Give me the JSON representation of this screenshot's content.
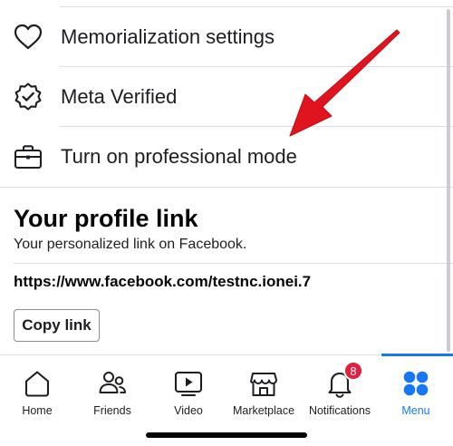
{
  "menu": {
    "items": [
      {
        "label": "Memorialization settings",
        "icon": "heart-icon"
      },
      {
        "label": "Meta Verified",
        "icon": "verified-badge-icon"
      },
      {
        "label": "Turn on professional mode",
        "icon": "briefcase-icon"
      }
    ]
  },
  "profile_link": {
    "title": "Your profile link",
    "subtitle": "Your personalized link on Facebook.",
    "url": "https://www.facebook.com/testnc.ionei.7",
    "copy_label": "Copy link"
  },
  "tabbar": {
    "tabs": [
      {
        "label": "Home",
        "icon": "home-icon"
      },
      {
        "label": "Friends",
        "icon": "friends-icon"
      },
      {
        "label": "Video",
        "icon": "video-icon"
      },
      {
        "label": "Marketplace",
        "icon": "marketplace-icon"
      },
      {
        "label": "Notifications",
        "icon": "bell-icon",
        "badge": "8"
      },
      {
        "label": "Menu",
        "icon": "menu-grid-icon",
        "active": true
      }
    ]
  },
  "colors": {
    "accent": "#1877f2",
    "badge": "#e41e3f",
    "annotation_arrow": "#e0141e"
  }
}
